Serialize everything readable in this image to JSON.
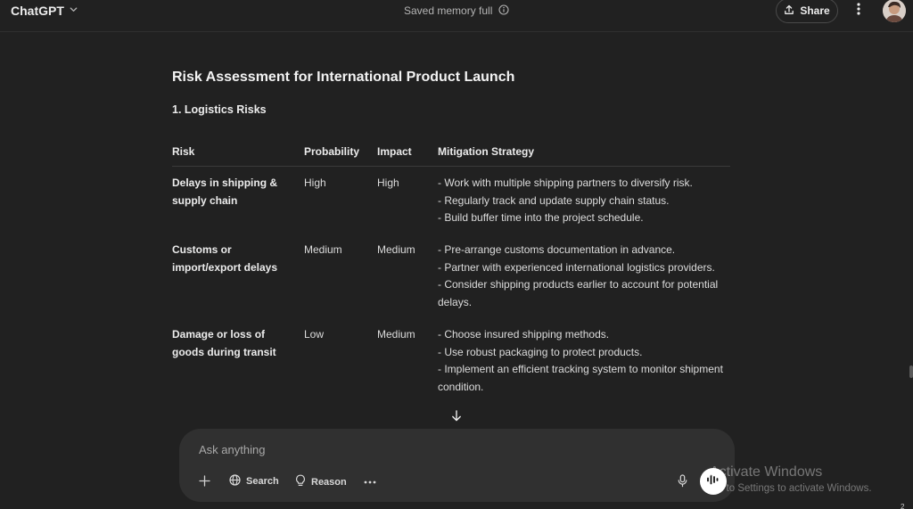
{
  "header": {
    "model_name": "ChatGPT",
    "memory_status": "Saved memory full",
    "share_label": "Share",
    "icons": {
      "model_dropdown": "chevron-down-icon",
      "memory_info": "info-icon",
      "share": "upload-icon",
      "more": "more-vertical-icon"
    }
  },
  "document": {
    "title": "Risk Assessment for International Product Launch",
    "section_title": "1. Logistics Risks",
    "table": {
      "headers": [
        "Risk",
        "Probability",
        "Impact",
        "Mitigation Strategy"
      ],
      "rows": [
        {
          "risk": "Delays in shipping & supply chain",
          "probability": "High",
          "impact": "High",
          "mitigation": [
            "- Work with multiple shipping partners to diversify risk.",
            "- Regularly track and update supply chain status.",
            "- Build buffer time into the project schedule."
          ]
        },
        {
          "risk": "Customs or import/export delays",
          "probability": "Medium",
          "impact": "Medium",
          "mitigation": [
            "- Pre-arrange customs documentation in advance.",
            "- Partner with experienced international logistics providers.",
            "- Consider shipping products earlier to account for potential delays."
          ]
        },
        {
          "risk": "Damage or loss of goods during transit",
          "probability": "Low",
          "impact": "Medium",
          "mitigation": [
            "- Choose insured shipping methods.",
            "- Use robust packaging to protect products.",
            "- Implement an efficient tracking system to monitor shipment condition."
          ]
        }
      ]
    }
  },
  "composer": {
    "placeholder": "Ask anything",
    "search_label": "Search",
    "reason_label": "Reason",
    "icons": {
      "attach": "plus-icon",
      "search": "globe-icon",
      "reason": "lightbulb-icon",
      "more": "more-horizontal-icon",
      "mic": "microphone-icon",
      "voice": "voice-mode-icon",
      "scroll": "arrow-down-icon"
    }
  },
  "watermark": {
    "line1": "Activate Windows",
    "line2": "Go to Settings to activate Windows."
  },
  "corner_mark": "2",
  "colors": {
    "background": "#212121",
    "composer": "#303030",
    "text": "#ececec"
  }
}
